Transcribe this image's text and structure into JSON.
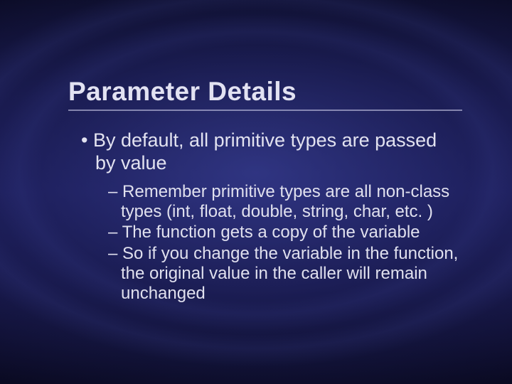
{
  "slide": {
    "title": "Parameter Details",
    "bullet1": "By default, all primitive types are passed by value",
    "sub1": "Remember primitive types are all non-class types (int, float, double, string, char, etc. )",
    "sub2": "The function gets a copy of the variable",
    "sub3": "So if you change the variable in the function, the original value in the caller will remain unchanged"
  }
}
